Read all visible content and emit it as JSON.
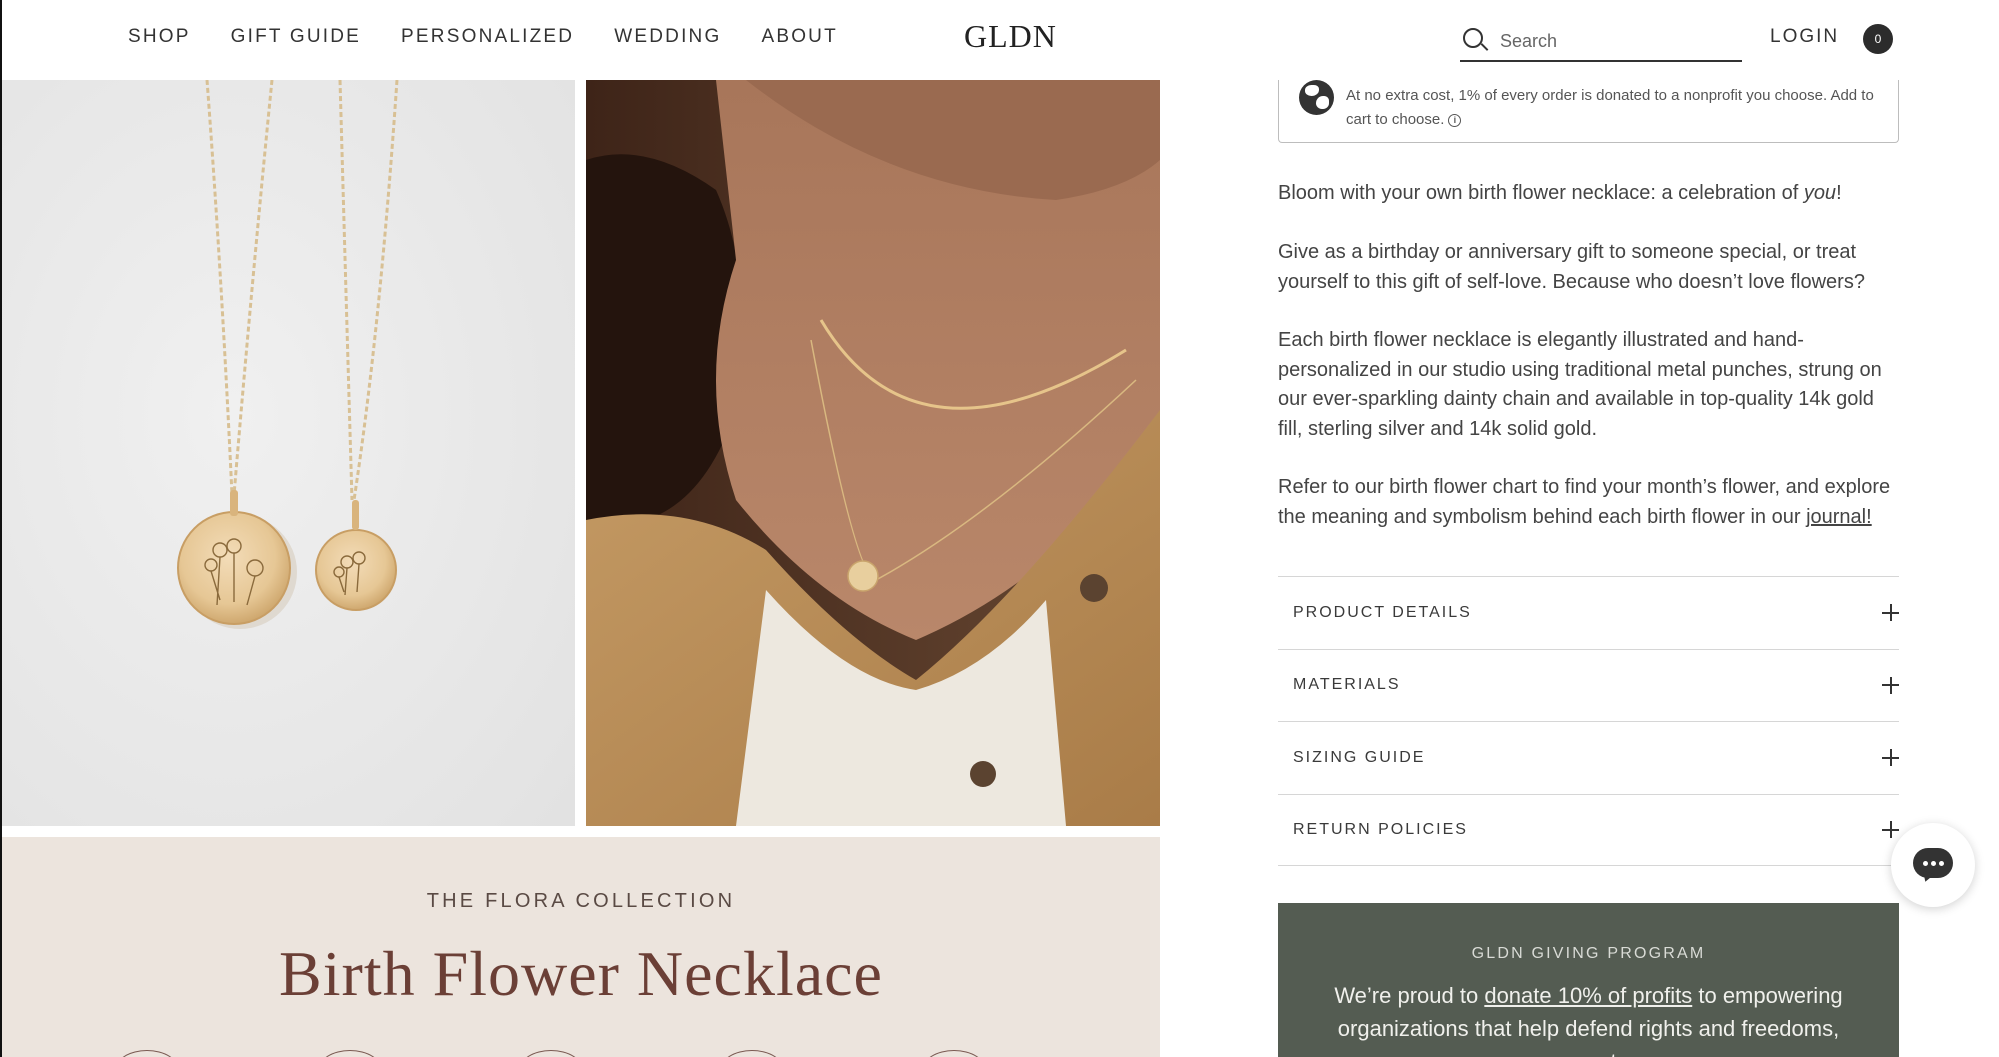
{
  "header": {
    "nav": [
      "SHOP",
      "GIFT GUIDE",
      "PERSONALIZED",
      "WEDDING",
      "ABOUT"
    ],
    "logo": "GLDN",
    "search_placeholder": "Search",
    "login": "LOGIN",
    "cart_count": "0"
  },
  "donation": {
    "text": "At no extra cost, 1% of every order is donated to a nonprofit you choose. Add to cart to choose."
  },
  "description": {
    "p1_before": "Bloom with your own birth flower necklace: a celebration of ",
    "p1_em": "you",
    "p1_after": "!",
    "p2": "Give as a birthday or anniversary gift to someone special, or treat yourself to this gift of self-love. Because who doesn’t love flowers?",
    "p3": "Each birth flower necklace is elegantly illustrated and hand-personalized in our studio using traditional metal punches, strung on our ever-sparkling dainty chain and available in top-quality 14k gold fill, sterling silver and 14k solid gold.",
    "p4_before": "Refer to our birth flower chart to find your month’s flower, and explore the meaning and symbolism behind each birth flower in our ",
    "p4_link": "journal!"
  },
  "accordion": [
    "PRODUCT DETAILS",
    "MATERIALS",
    "SIZING GUIDE",
    "RETURN POLICIES"
  ],
  "collection": {
    "eyebrow": "THE FLORA COLLECTION",
    "title": "Birth Flower Necklace"
  },
  "giving": {
    "eyebrow": "GLDN GIVING PROGRAM",
    "text_before": "We’re proud to ",
    "link": "donate 10% of profits",
    "text_after": " to empowering organizations that help defend rights and freedoms, promote"
  },
  "colors": {
    "giving_bg": "#545c52",
    "collection_bg": "#ece4dd",
    "title_color": "#6b3f36"
  }
}
